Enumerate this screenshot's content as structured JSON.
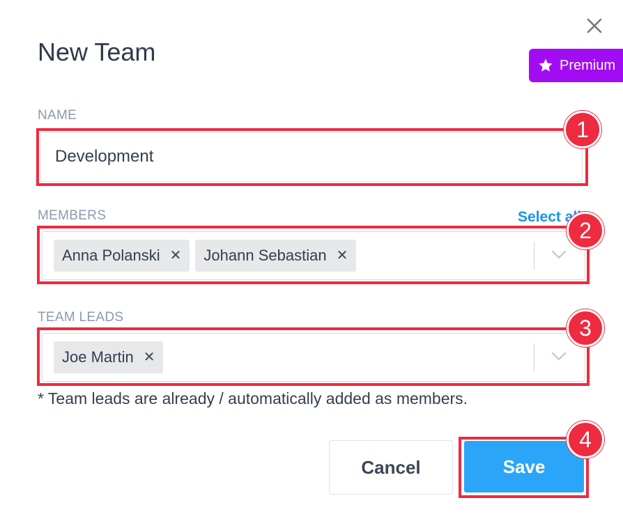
{
  "dialog": {
    "title": "New Team",
    "premium_label": "Premium"
  },
  "name": {
    "label": "NAME",
    "value": "Development"
  },
  "members": {
    "label": "MEMBERS",
    "select_all": "Select all",
    "tags": [
      "Anna Polanski",
      "Johann Sebastian"
    ]
  },
  "team_leads": {
    "label": "TEAM LEADS",
    "tags": [
      "Joe Martin"
    ],
    "note": "* Team leads are already / automatically added as members."
  },
  "actions": {
    "cancel": "Cancel",
    "save": "Save"
  },
  "annotations": [
    "1",
    "2",
    "3",
    "4"
  ],
  "colors": {
    "accent": "#2ba5f7",
    "premium": "#a20cf2",
    "highlight": "#ee2b3f",
    "link": "#1496e6"
  }
}
